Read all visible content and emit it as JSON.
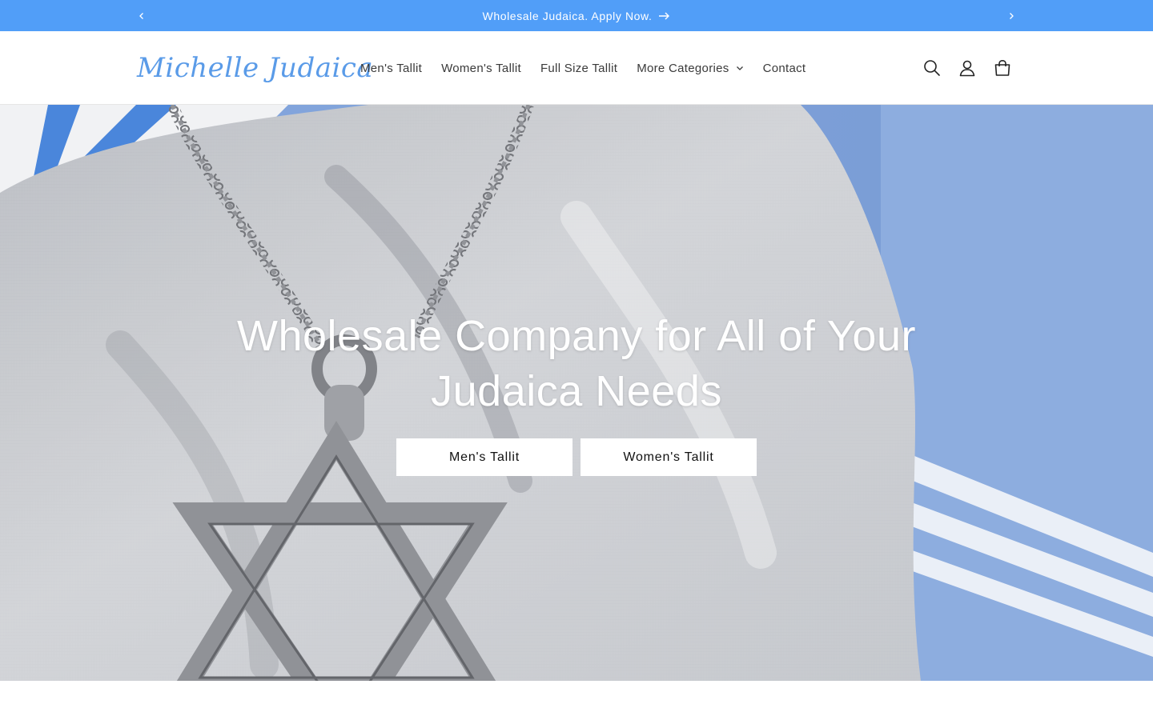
{
  "announcement": {
    "text": "Wholesale Judaica. Apply Now.",
    "prev_icon": "chevron-left-icon",
    "next_icon": "chevron-right-icon",
    "arrow_icon": "arrow-right-icon",
    "background": "#519ef8"
  },
  "header": {
    "logo_text": "Michelle Judaica",
    "logo_color": "#5a9be8",
    "nav": [
      {
        "label": "Men's Tallit"
      },
      {
        "label": "Women's Tallit"
      },
      {
        "label": "Full Size Tallit"
      },
      {
        "label": "More Categories",
        "has_dropdown": true
      },
      {
        "label": "Contact"
      }
    ],
    "icons": [
      "search-icon",
      "account-icon",
      "cart-icon"
    ]
  },
  "hero": {
    "title_line1": "Wholesale Company for All of Your",
    "title_line2": "Judaica Needs",
    "buttons": [
      {
        "label": "Men's Tallit"
      },
      {
        "label": "Women's Tallit"
      }
    ]
  }
}
